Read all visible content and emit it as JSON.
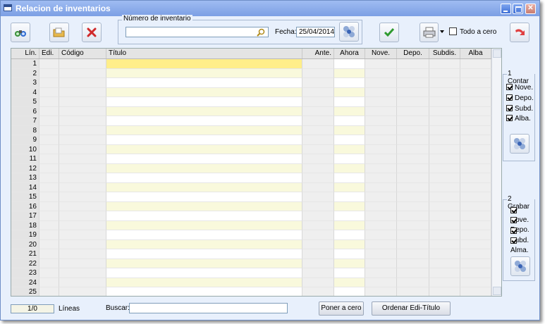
{
  "window": {
    "title": "Relacion de inventarios"
  },
  "toolbar": {
    "inventario_label": "Número de inventario",
    "inventario_value": "",
    "fecha_label": "Fecha:",
    "fecha_value": "25/04/2014",
    "todo_cero_label": "Todo a cero"
  },
  "grid": {
    "headers": [
      "Lín.",
      "Edi.",
      "Código",
      "Título",
      "Ante.",
      "Ahora",
      "Nove.",
      "Depo.",
      "Subdis.",
      "Alba"
    ],
    "rows": [
      "1",
      "2",
      "3",
      "4",
      "5",
      "6",
      "7",
      "8",
      "9",
      "10",
      "11",
      "12",
      "13",
      "14",
      "15",
      "16",
      "17",
      "18",
      "19",
      "20",
      "21",
      "22",
      "23",
      "24",
      "25"
    ]
  },
  "contar": {
    "title": "1 Contar",
    "items": [
      "Nove.",
      "Depo.",
      "Subd.",
      "Alba."
    ]
  },
  "grabar": {
    "title": "2 Grabar",
    "items": [
      "Nove.",
      "Depo.",
      "Subd.",
      "Alma."
    ]
  },
  "footer": {
    "counter": "1/0",
    "lineas_label": "Líneas",
    "buscar_label": "Buscar:",
    "buscar_value": "",
    "poner_cero": "Poner a cero",
    "ordenar": "Ordenar Edi-Título"
  },
  "colors": {
    "selected_cell": "#ffee8a",
    "alt_row": "#f9f9dc",
    "window_bg": "#e8f0fc"
  }
}
